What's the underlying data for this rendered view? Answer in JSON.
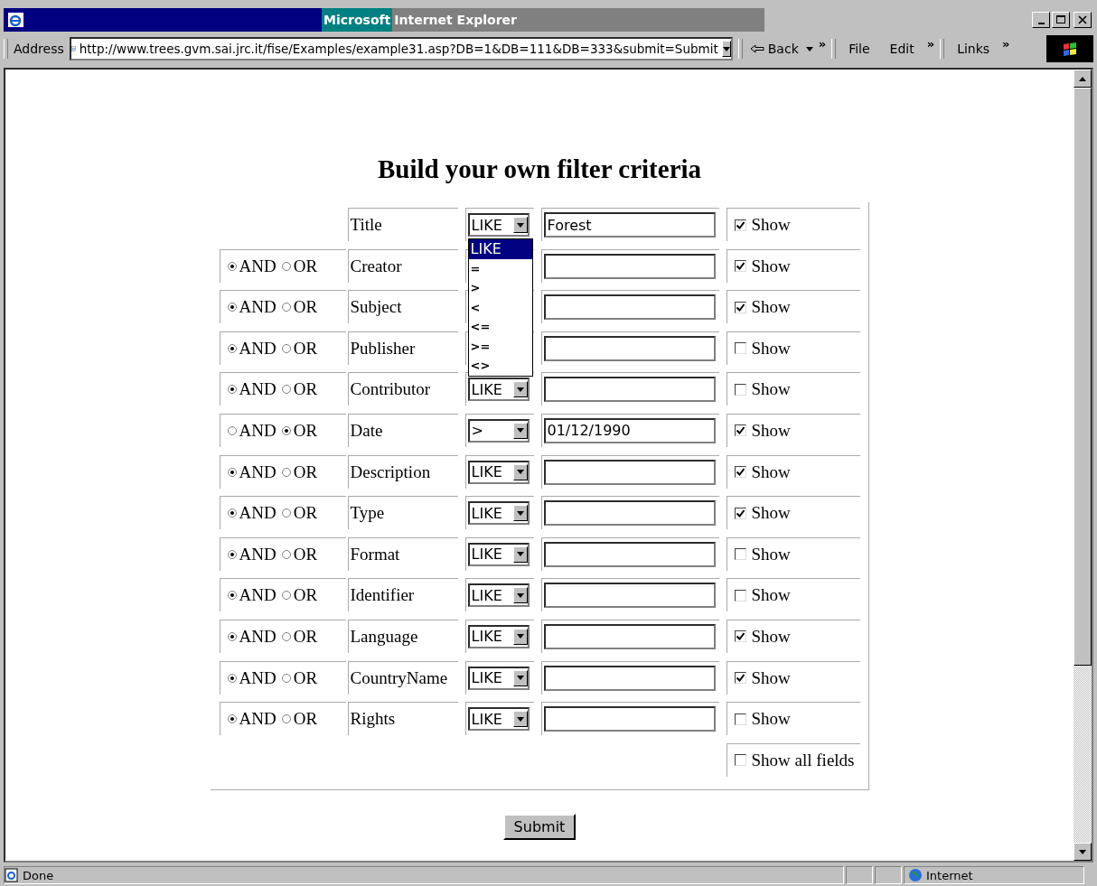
{
  "window": {
    "title_part1": "Microsoft",
    "title_part2": "Internet Explorer"
  },
  "toolbar": {
    "address_label": "Address",
    "url": "http://www.trees.gvm.sai.jrc.it/fise/Examples/example31.asp?DB=1&DB=111&DB=333&submit=Submit",
    "back": "Back",
    "chevron": "»",
    "menus": [
      "File",
      "Edit"
    ],
    "links": "Links"
  },
  "heading": "Build your own filter criteria",
  "rows": [
    {
      "field": "Title",
      "operator": "LIKE",
      "value": "Forest",
      "show_label": "Show",
      "show": true
    },
    {
      "conjunction": [
        {
          "label": "AND",
          "selected": true
        },
        {
          "label": "OR",
          "selected": false
        }
      ],
      "field": "Creator",
      "value": "",
      "show_label": "Show",
      "show": true
    },
    {
      "conjunction": [
        {
          "label": "AND",
          "selected": true
        },
        {
          "label": "OR",
          "selected": false
        }
      ],
      "field": "Subject",
      "value": "",
      "show_label": "Show",
      "show": true
    },
    {
      "conjunction": [
        {
          "label": "AND",
          "selected": true
        },
        {
          "label": "OR",
          "selected": false
        }
      ],
      "field": "Publisher",
      "value": "",
      "show_label": "Show",
      "show": false
    },
    {
      "conjunction": [
        {
          "label": "AND",
          "selected": true
        },
        {
          "label": "OR",
          "selected": false
        }
      ],
      "field": "Contributor",
      "operator": "LIKE",
      "value": "",
      "show_label": "Show",
      "show": false
    },
    {
      "conjunction": [
        {
          "label": "AND",
          "selected": false
        },
        {
          "label": "OR",
          "selected": true
        }
      ],
      "field": "Date",
      "operator": ">",
      "value": "01/12/1990",
      "show_label": "Show",
      "show": true
    },
    {
      "conjunction": [
        {
          "label": "AND",
          "selected": true
        },
        {
          "label": "OR",
          "selected": false
        }
      ],
      "field": "Description",
      "operator": "LIKE",
      "value": "",
      "show_label": "Show",
      "show": true
    },
    {
      "conjunction": [
        {
          "label": "AND",
          "selected": true
        },
        {
          "label": "OR",
          "selected": false
        }
      ],
      "field": "Type",
      "operator": "LIKE",
      "value": "",
      "show_label": "Show",
      "show": true
    },
    {
      "conjunction": [
        {
          "label": "AND",
          "selected": true
        },
        {
          "label": "OR",
          "selected": false
        }
      ],
      "field": "Format",
      "operator": "LIKE",
      "value": "",
      "show_label": "Show",
      "show": false
    },
    {
      "conjunction": [
        {
          "label": "AND",
          "selected": true
        },
        {
          "label": "OR",
          "selected": false
        }
      ],
      "field": "Identifier",
      "operator": "LIKE",
      "value": "",
      "show_label": "Show",
      "show": false
    },
    {
      "conjunction": [
        {
          "label": "AND",
          "selected": true
        },
        {
          "label": "OR",
          "selected": false
        }
      ],
      "field": "Language",
      "operator": "LIKE",
      "value": "",
      "show_label": "Show",
      "show": true
    },
    {
      "conjunction": [
        {
          "label": "AND",
          "selected": true
        },
        {
          "label": "OR",
          "selected": false
        }
      ],
      "field": "CountryName",
      "operator": "LIKE",
      "value": "",
      "show_label": "Show",
      "show": true
    },
    {
      "conjunction": [
        {
          "label": "AND",
          "selected": true
        },
        {
          "label": "OR",
          "selected": false
        }
      ],
      "field": "Rights",
      "operator": "LIKE",
      "value": "",
      "show_label": "Show",
      "show": false
    }
  ],
  "show_all": {
    "label": "Show all fields",
    "checked": false
  },
  "dropdown_options": [
    {
      "label": "LIKE",
      "selected": true
    },
    {
      "label": "=",
      "selected": false
    },
    {
      "label": ">",
      "selected": false
    },
    {
      "label": "<",
      "selected": false
    },
    {
      "label": "<=",
      "selected": false
    },
    {
      "label": ">=",
      "selected": false
    },
    {
      "label": "<>",
      "selected": false
    }
  ],
  "submit": "Submit",
  "status_bar": {
    "text": "Done",
    "zone": "Internet"
  }
}
